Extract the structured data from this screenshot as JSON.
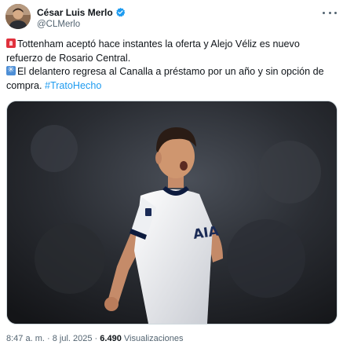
{
  "author": {
    "display_name": "César Luis Merlo",
    "handle": "@CLMerlo",
    "verified": true,
    "avatar_icon": "profile-photo",
    "verified_icon": "verified-badge-icon",
    "more_icon": "more-options-icon"
  },
  "tweet": {
    "line1_emoji": "siren-emoji",
    "line1": "Tottenham aceptó hace instantes la oferta y Alejo Véliz es nuevo",
    "line2": "refuerzo de Rosario Central.",
    "line3_emoji": "eight-spoked-asterisk-emoji",
    "line3": "El delantero regresa al Canalla a préstamo por un año y sin opción de",
    "line4": "compra.",
    "hashtag": "#TratoHecho"
  },
  "media": {
    "type": "photo",
    "kit_text": "AIA",
    "description": "Footballer in white Tottenham kit celebrating against a dark stadium background"
  },
  "meta": {
    "time": "8:47 a. m.",
    "separator": "·",
    "date": "8 jul. 2025",
    "views_count": "6.490",
    "views_label": "Visualizaciones"
  },
  "colors": {
    "link": "#1d9bf0",
    "verified": "#1d9bf0",
    "text": "#0f1419",
    "secondary": "#536471"
  }
}
